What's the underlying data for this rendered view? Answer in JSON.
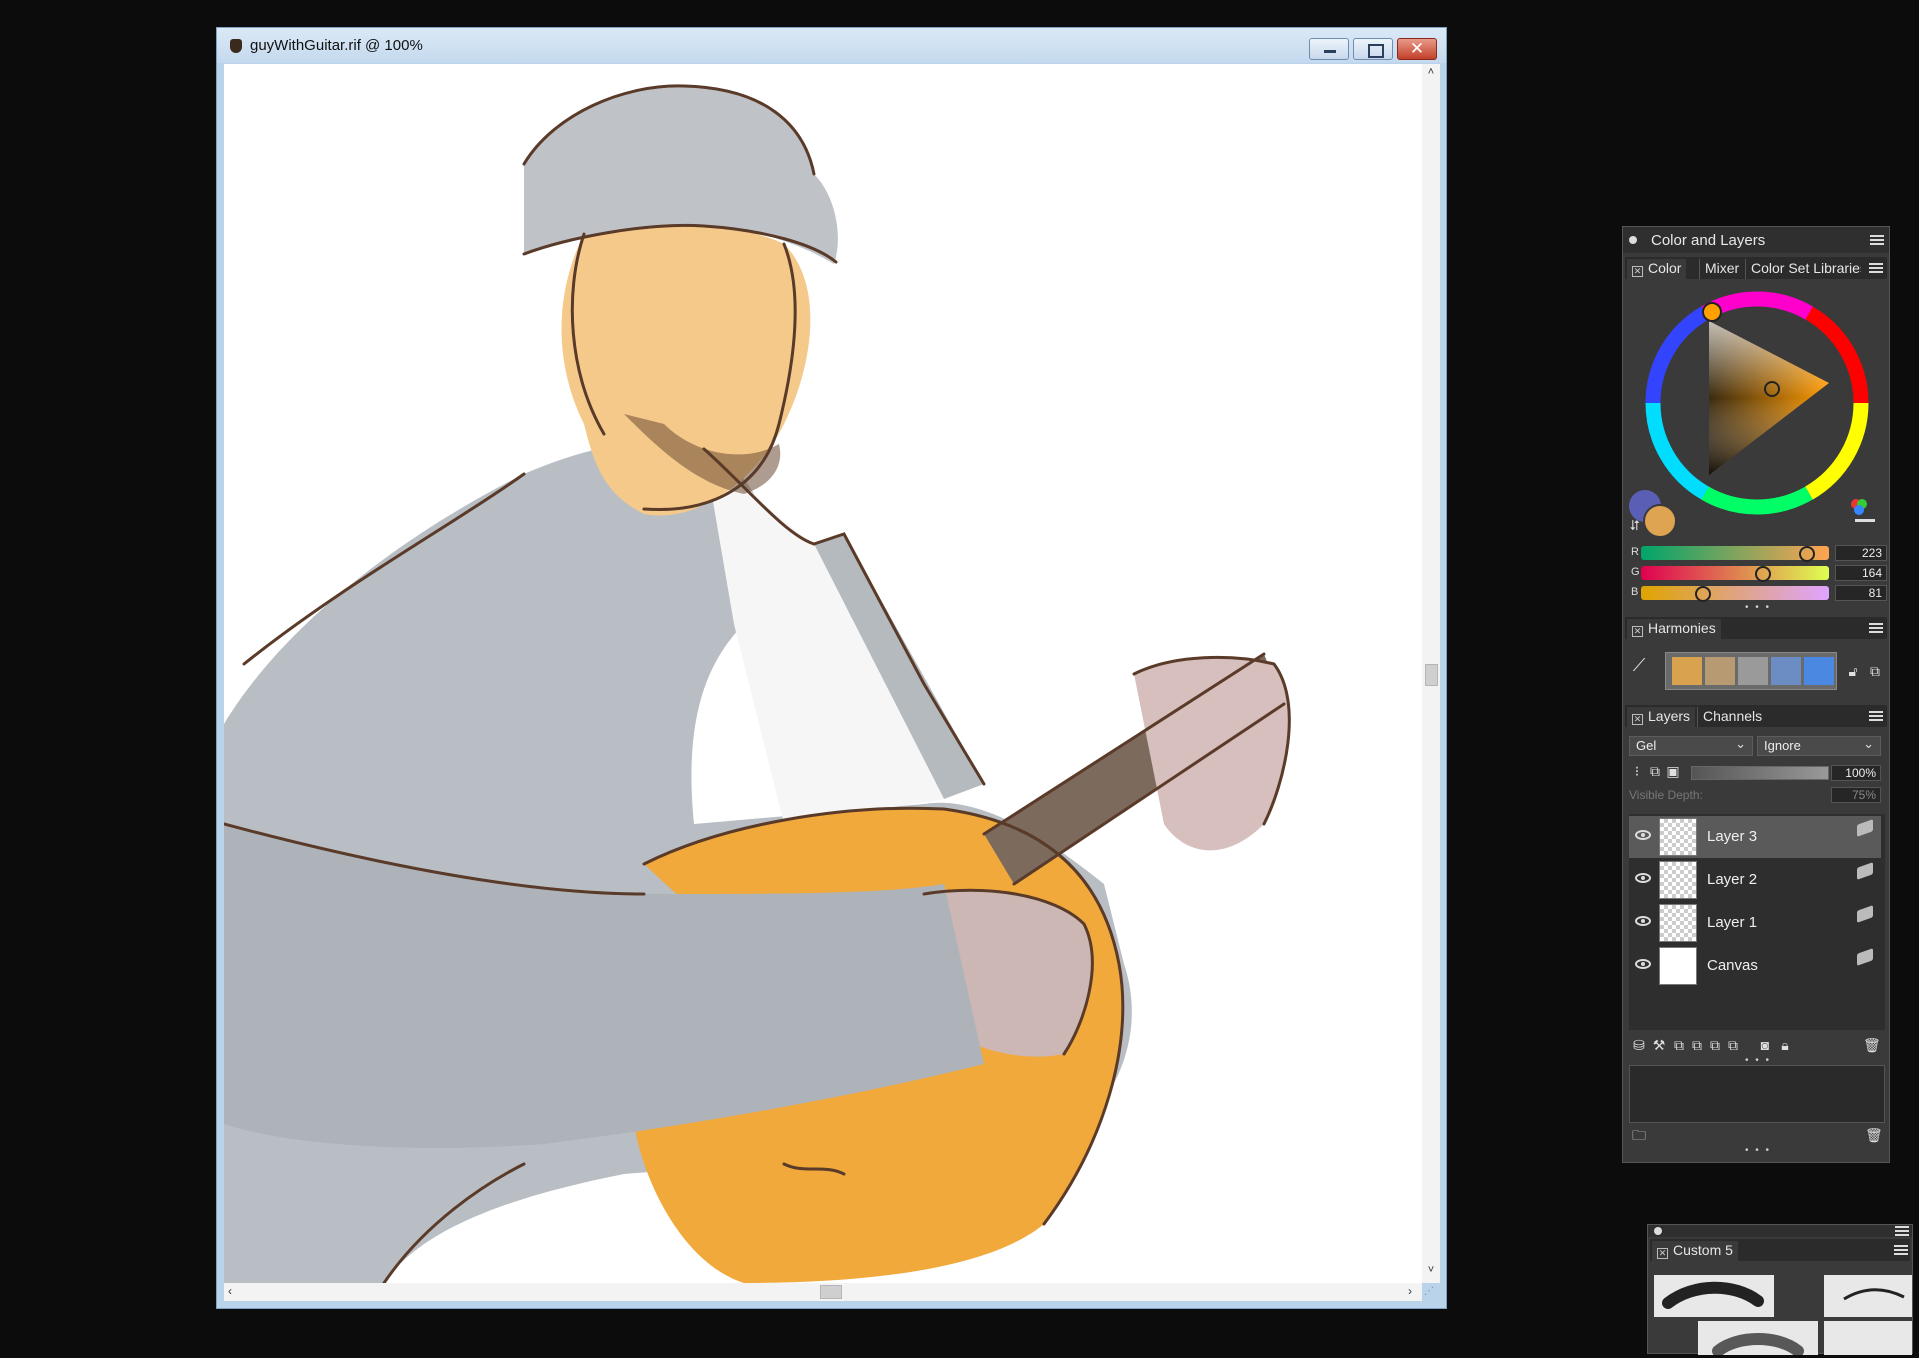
{
  "document": {
    "title": "guyWithGuitar.rif @ 100%",
    "close_glyph": "✕",
    "scroll_up": "˄",
    "scroll_down": "˅",
    "scroll_left": "‹",
    "scroll_right": "›"
  },
  "color_panel": {
    "title": "Color and Layers",
    "tabs": [
      "Color",
      "Mixer",
      "Color Set Libraries"
    ],
    "sliders": [
      {
        "letter": "R",
        "value": "223",
        "fraction": 0.87
      },
      {
        "letter": "G",
        "value": "164",
        "fraction": 0.64
      },
      {
        "letter": "B",
        "value": "81",
        "fraction": 0.32
      }
    ],
    "main_color": "#dfa451",
    "secondary_color": "#5a5fb5",
    "more_dots": "• • •"
  },
  "harmonies": {
    "title": "Harmonies",
    "swatches": [
      "#d9a24e",
      "#b89a72",
      "#9a9a9a",
      "#6b8dc4",
      "#4a88e2"
    ]
  },
  "layers_panel": {
    "tabs": [
      "Layers",
      "Channels"
    ],
    "composite_method": "Gel",
    "paper_mode": "Ignore",
    "opacity": "100%",
    "visible_depth_label": "Visible Depth:",
    "visible_depth": "75%",
    "layers": [
      {
        "name": "Layer 3",
        "selected": true
      },
      {
        "name": "Layer 2",
        "selected": false
      },
      {
        "name": "Layer 1",
        "selected": false
      },
      {
        "name": "Canvas",
        "selected": false
      }
    ],
    "more_dots": "• • •"
  },
  "brush_panel": {
    "title": "Custom 5"
  }
}
